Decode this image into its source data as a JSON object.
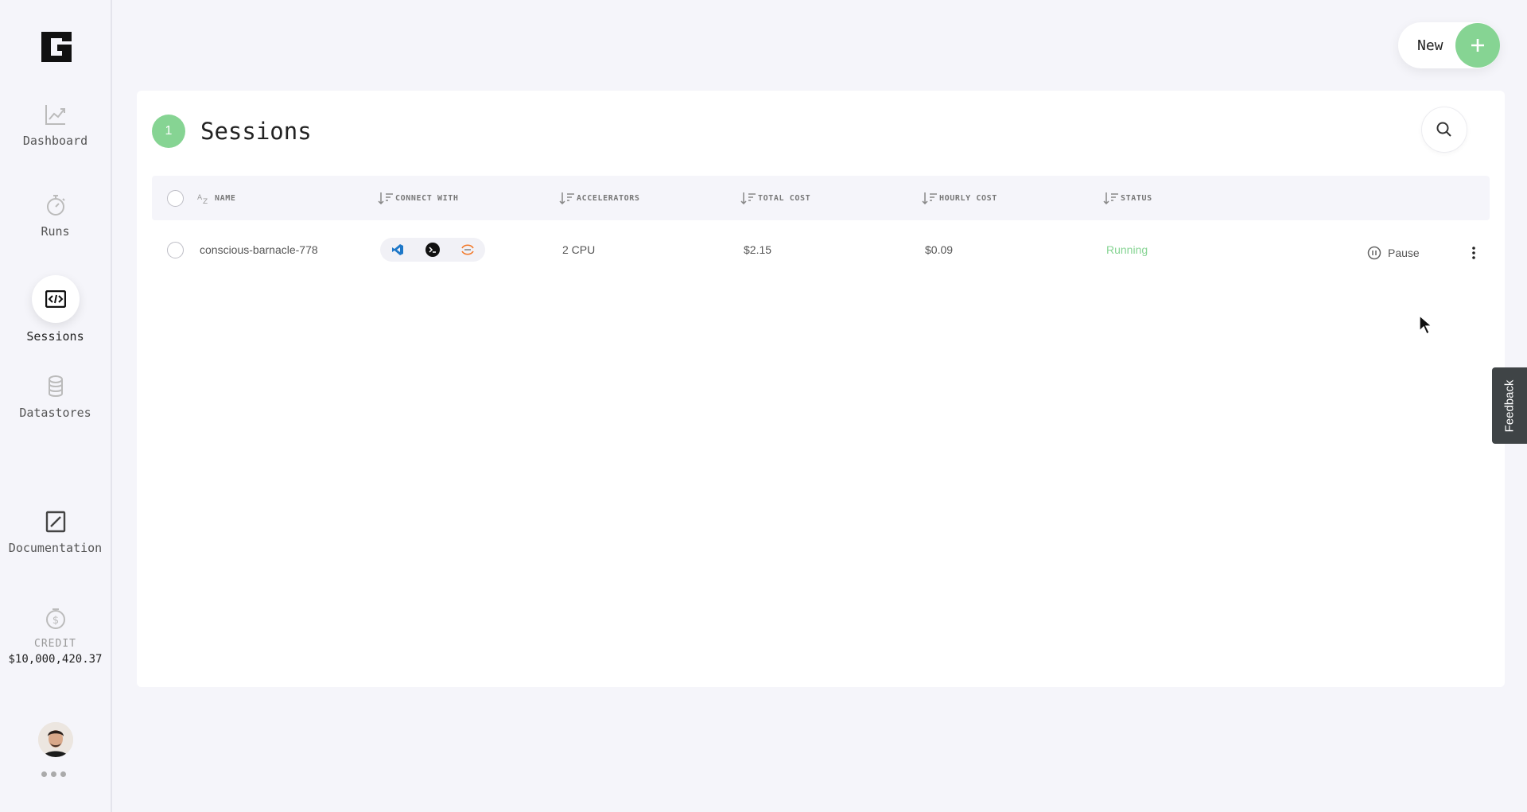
{
  "sidebar": {
    "items": [
      {
        "label": "Dashboard",
        "icon": "chart-line-icon"
      },
      {
        "label": "Runs",
        "icon": "stopwatch-icon"
      },
      {
        "label": "Sessions",
        "icon": "code-window-icon",
        "active": true
      },
      {
        "label": "Datastores",
        "icon": "database-icon"
      },
      {
        "label": "Documentation",
        "icon": "document-edit-icon"
      }
    ],
    "credit_label": "CREDIT",
    "credit_value": "$10,000,420.37"
  },
  "header": {
    "new_label": "New"
  },
  "sessions": {
    "count": "1",
    "title": "Sessions",
    "columns": {
      "name": "Name",
      "connect_with": "Connect with",
      "accelerators": "Accelerators",
      "total_cost": "Total cost",
      "hourly_cost": "Hourly cost",
      "status": "Status"
    },
    "rows": [
      {
        "name": "conscious-barnacle-778",
        "connect_with": [
          "vscode-icon",
          "terminal-icon",
          "jupyter-icon"
        ],
        "accelerators": "2 CPU",
        "total_cost": "$2.15",
        "hourly_cost": "$0.09",
        "status": "Running",
        "action": "Pause"
      }
    ]
  },
  "feedback_label": "Feedback",
  "colors": {
    "accent_green": "#86d493",
    "background": "#f5f5fa",
    "feedback_bg": "#3f4446"
  }
}
